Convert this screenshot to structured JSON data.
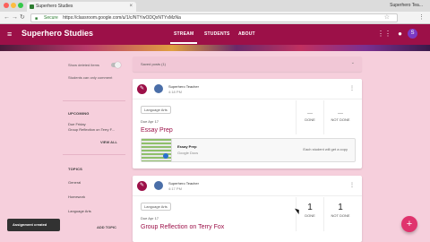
{
  "browser": {
    "tab_title": "Superhero Studies",
    "tab_close": "×",
    "profile_name": "Superhero Tea...",
    "secure_label": "Secure",
    "url": "https://classroom.google.com/u/1/c/NTYwODQxNTYxMzNa",
    "nav": {
      "back": "←",
      "forward": "→",
      "reload": "↻"
    },
    "menu_glyph": "⋮",
    "star_glyph": "☆"
  },
  "app": {
    "title": "Superhero Studies",
    "tabs": [
      {
        "label": "STREAM",
        "active": true
      },
      {
        "label": "STUDENTS",
        "active": false
      },
      {
        "label": "ABOUT",
        "active": false
      }
    ],
    "avatar_letter": "S",
    "brand_color": "#9c1048",
    "hamburger_glyph": "≡",
    "grid_glyph": "⋮⋮",
    "notify_glyph": "●"
  },
  "sidebar": {
    "toggle_label": "Show deleted items",
    "note": "Students can only comment",
    "upcoming_heading": "UPCOMING",
    "upcoming_when": "Due Friday",
    "upcoming_item": "Group Reflection on Terry F...",
    "view_all": "VIEW ALL",
    "topics_heading": "TOPICS",
    "topics": [
      "General",
      "Homework",
      "Language Arts"
    ],
    "add_topic": "ADD TOPIC"
  },
  "composer": {
    "placeholder": "Saved posts (1)",
    "arrow": "⌄"
  },
  "posts": [
    {
      "icon": "✎",
      "author": "Superhero Teacher",
      "time": "4:18 PM",
      "menu": "⋮",
      "topic": "Language Arts",
      "due": "Due Apr 17",
      "title": "Essay Prep",
      "done_value": "---",
      "done_label": "DONE",
      "not_done_value": "---",
      "not_done_label": "NOT DONE",
      "attachment_title": "Essay Prep",
      "attachment_sub": "Google Docs",
      "attachment_note": "Each student will get a copy"
    },
    {
      "icon": "✎",
      "author": "Superhero Teacher",
      "time": "4:17 PM",
      "menu": "⋮",
      "topic": "Language Arts",
      "due": "Due Apr 17",
      "title": "Group Reflection on Terry Fox",
      "done_value": "1",
      "done_label": "DONE",
      "not_done_value": "1",
      "not_done_label": "NOT DONE"
    }
  ],
  "snackbar": "Assignment created",
  "fab": "+"
}
